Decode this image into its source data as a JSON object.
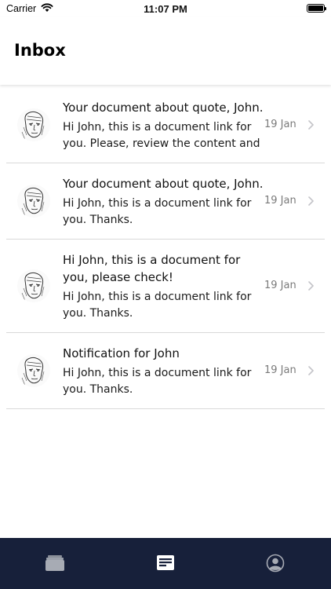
{
  "status_bar": {
    "carrier": "Carrier",
    "time": "11:07 PM"
  },
  "header": {
    "title": "Inbox"
  },
  "messages": [
    {
      "subject": "Your document about quote, John.",
      "preview": "Hi John, this is a document link for you. Please, review the content and m",
      "date": "19 Jan"
    },
    {
      "subject": "Your document about quote, John.",
      "preview": "Hi John, this is a document link for you. Thanks.",
      "date": "19 Jan"
    },
    {
      "subject": "Hi John, this is a document for you, please check!",
      "preview": "Hi John, this is a document link for you. Thanks.",
      "date": "19 Jan"
    },
    {
      "subject": "Notification for John",
      "preview": "Hi John, this is a document link for you. Thanks.",
      "date": "19 Jan"
    }
  ],
  "tab_bar": {
    "background": "#17203a",
    "tabs": [
      {
        "icon": "stack-icon",
        "selected": false
      },
      {
        "icon": "inbox-icon",
        "selected": true
      },
      {
        "icon": "profile-icon",
        "selected": false
      }
    ]
  }
}
